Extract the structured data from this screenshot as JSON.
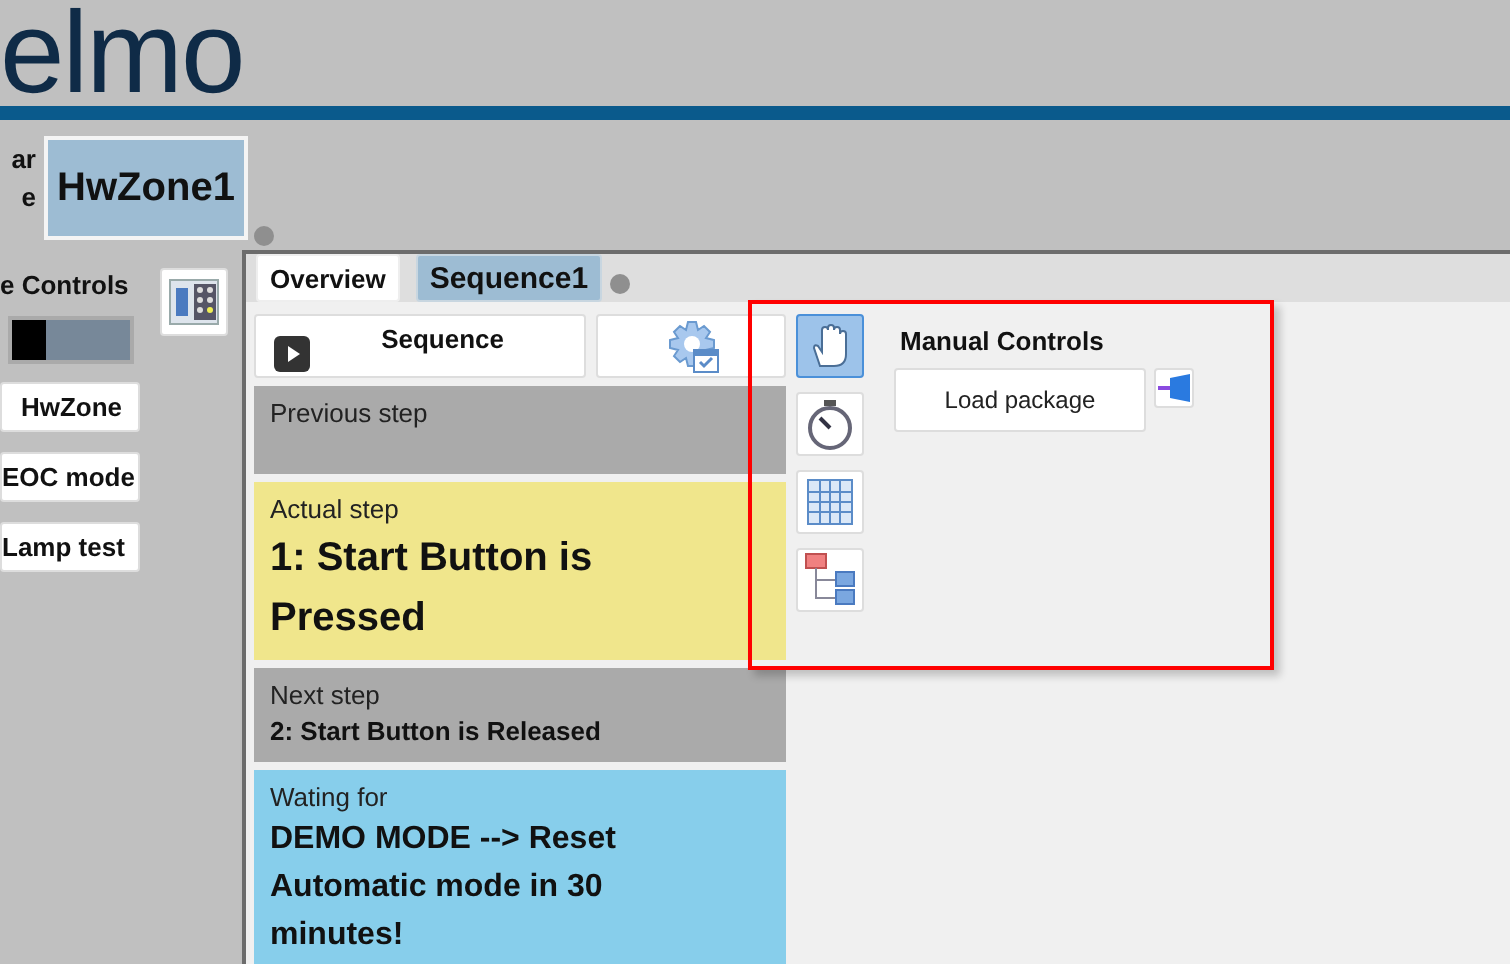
{
  "logo": "elmo",
  "zone": {
    "labels": [
      "ar",
      "e"
    ],
    "name": "HwZone1"
  },
  "sidebar": {
    "title": "e Controls",
    "toggle": {
      "on": false
    },
    "buttons": [
      "HwZone",
      "EOC mode",
      "Lamp test"
    ]
  },
  "tabs": [
    {
      "label": "Overview",
      "selected": false
    },
    {
      "label": "Sequence1",
      "selected": true
    }
  ],
  "sequence": {
    "button": "Sequence",
    "steps": [
      {
        "kind": "previous",
        "label": "Previous step"
      },
      {
        "kind": "actual",
        "label": "Actual step",
        "text": "1: Start Button is Pressed"
      },
      {
        "kind": "next",
        "label": "Next step",
        "text": "2: Start Button is Released"
      },
      {
        "kind": "waiting",
        "label": "Wating for",
        "text": "DEMO MODE --> Reset Automatic mode in 30 minutes!"
      }
    ]
  },
  "tools": [
    {
      "kind": "hand",
      "selected": true
    },
    {
      "kind": "stopwatch",
      "selected": false
    },
    {
      "kind": "grid",
      "selected": false
    },
    {
      "kind": "tree",
      "selected": false
    }
  ],
  "manual": {
    "title": "Manual Controls",
    "button": "Load package"
  }
}
